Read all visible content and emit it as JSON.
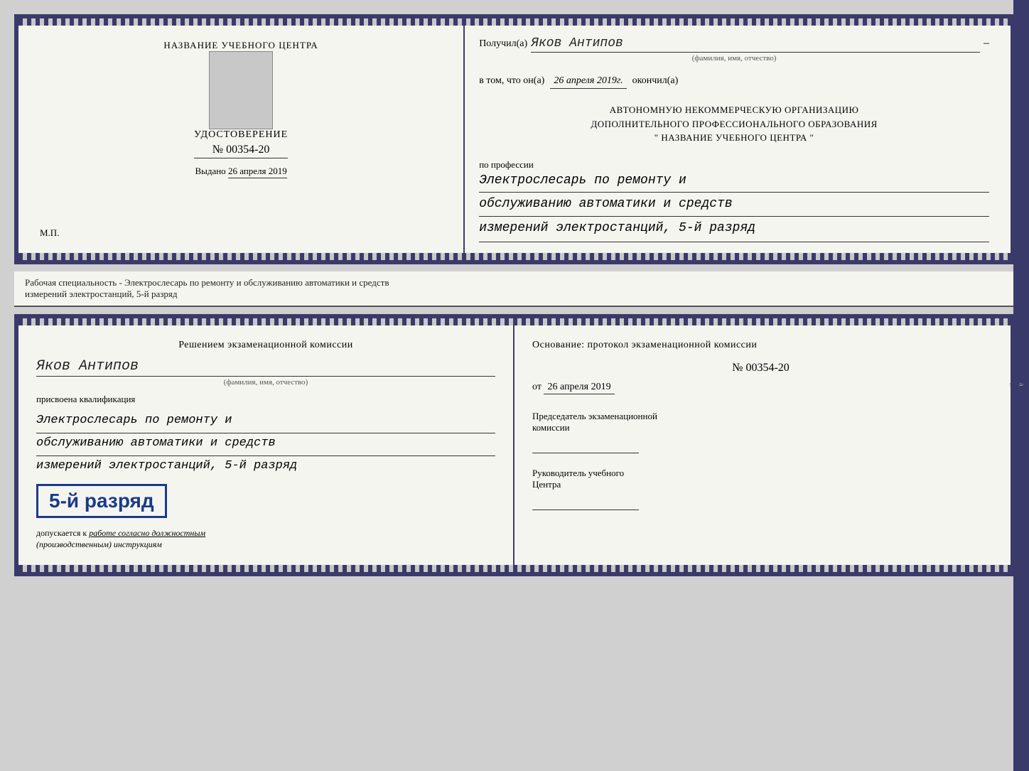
{
  "top_cert": {
    "left": {
      "center_title": "НАЗВАНИЕ УЧЕБНОГО ЦЕНТРА",
      "cert_label": "УДОСТОВЕРЕНИЕ",
      "cert_number": "№ 00354-20",
      "issued_label": "Выдано",
      "issued_date": "26 апреля 2019",
      "stamp_label": "М.П."
    },
    "right": {
      "recipient_label": "Получил(а)",
      "recipient_name": "Яков Антипов",
      "recipient_fio": "(фамилия, имя, отчество)",
      "completion_prefix": "в том, что он(а)",
      "completion_date": "26 апреля 2019г.",
      "completion_suffix": "окончил(а)",
      "org_line1": "АВТОНОМНУЮ НЕКОММЕРЧЕСКУЮ ОРГАНИЗАЦИЮ",
      "org_line2": "ДОПОЛНИТЕЛЬНОГО ПРОФЕССИОНАЛЬНОГО ОБРАЗОВАНИЯ",
      "org_line3": "\"   НАЗВАНИЕ УЧЕБНОГО ЦЕНТРА   \"",
      "profession_label": "по профессии",
      "profession_line1": "Электрослесарь по ремонту и",
      "profession_line2": "обслуживанию автоматики и средств",
      "profession_line3": "измерений электростанций, 5-й разряд"
    }
  },
  "middle_label": "Рабочая специальность - Электрослесарь по ремонту и обслуживанию автоматики и средств\nизмерений электростанций, 5-й разряд",
  "bottom_cert": {
    "left": {
      "decision_title": "Решением экзаменационной комиссии",
      "person_name": "Яков Антипов",
      "person_fio": "(фамилия, имя, отчество)",
      "qualification_label": "присвоена квалификация",
      "qual_line1": "Электрослесарь по ремонту и",
      "qual_line2": "обслуживанию автоматики и средств",
      "qual_line3": "измерений электростанций, 5-й разряд",
      "rank_label": "5-й разряд",
      "admission_prefix": "допускается к",
      "admission_text": "работе согласно должностным",
      "admission_suffix": "(производственным) инструкциям"
    },
    "right": {
      "basis_label": "Основание: протокол экзаменационной комиссии",
      "protocol_number": "№  00354-20",
      "protocol_date_prefix": "от",
      "protocol_date": "26 апреля 2019",
      "chairman_label": "Председатель экзаменационной",
      "chairman_label2": "комиссии",
      "director_label": "Руководитель учебного",
      "director_label2": "Центра"
    }
  }
}
